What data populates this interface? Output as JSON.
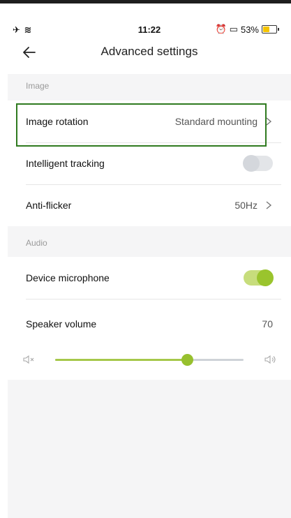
{
  "status_bar": {
    "icons_left": "✈ ≋",
    "time": "11:22",
    "battery_text": "53%",
    "battery_level": 0.53
  },
  "header": {
    "title": "Advanced settings",
    "back_icon": "arrow-left-icon"
  },
  "sections": {
    "image": {
      "label": "Image",
      "image_rotation": {
        "label": "Image rotation",
        "value": "Standard mounting"
      },
      "intelligent_tracking": {
        "label": "Intelligent tracking",
        "enabled": false
      },
      "anti_flicker": {
        "label": "Anti-flicker",
        "value": "50Hz"
      }
    },
    "audio": {
      "label": "Audio",
      "device_microphone": {
        "label": "Device microphone",
        "enabled": true
      },
      "speaker_volume": {
        "label": "Speaker volume",
        "value": "70",
        "level": 0.7
      }
    }
  },
  "colors": {
    "accent": "#9ac42d",
    "highlight_border": "#2f7a1f",
    "battery": "#f5c400"
  }
}
